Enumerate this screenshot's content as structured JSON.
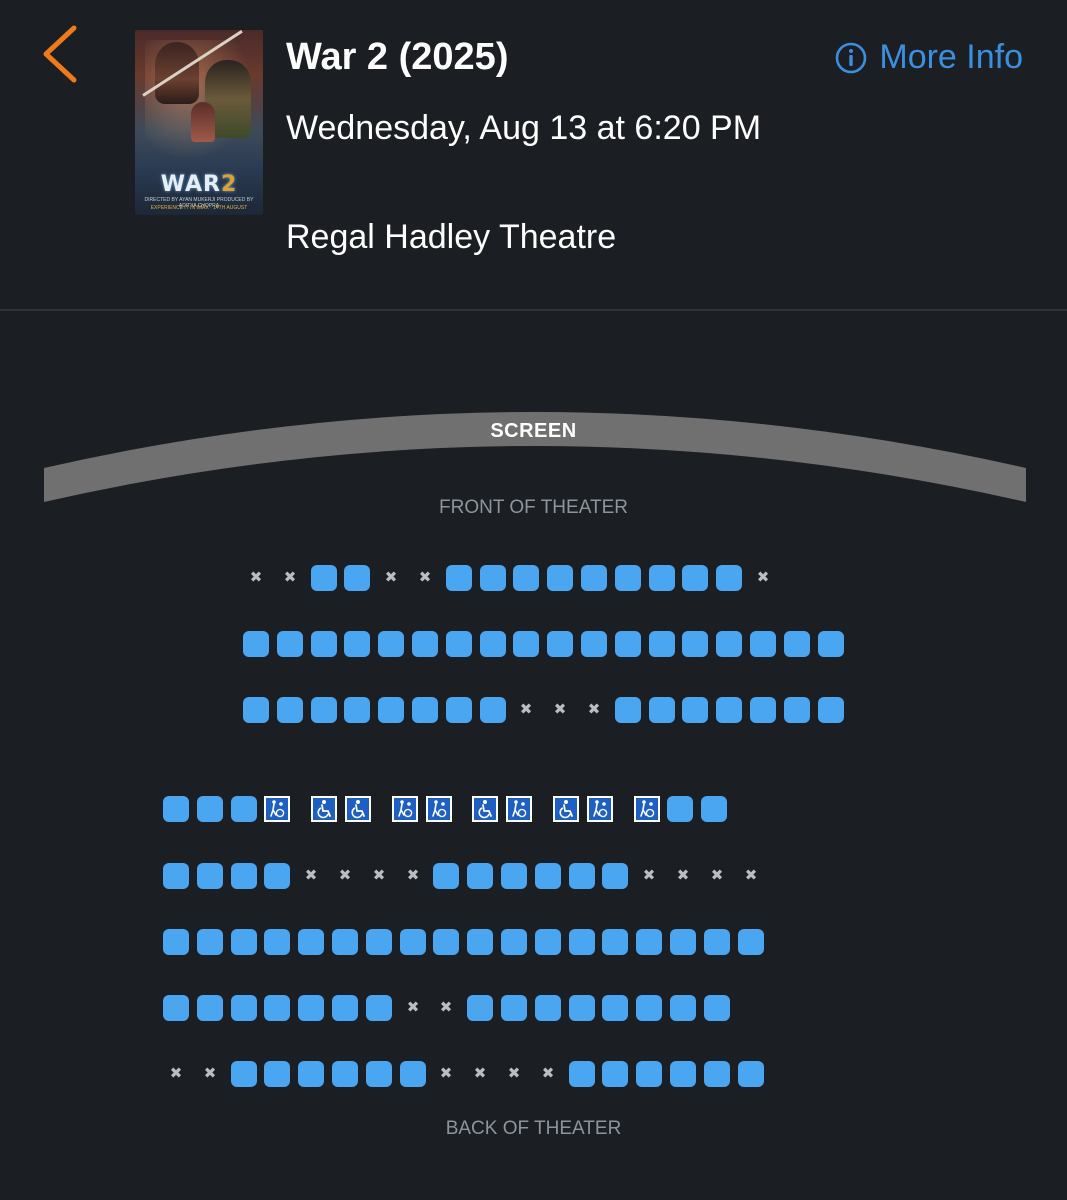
{
  "header": {
    "back_icon": "chevron-left-icon",
    "poster": {
      "title_part1": "WAR",
      "title_part2": "2",
      "credits": "DIRECTED BY AYAN MUKERJI   PRODUCED BY ADITYA CHOPRA",
      "imax": "EXPERIENCE IT IN IMAX · 14TH AUGUST"
    },
    "movie_title": "War 2 (2025)",
    "showtime": "Wednesday, Aug 13 at 6:20 PM",
    "theatre": "Regal Hadley Theatre",
    "more_info_label": "More Info",
    "more_info_icon": "info-circle-icon"
  },
  "seatmap": {
    "screen_label": "SCREEN",
    "front_label": "FRONT OF THEATER",
    "back_label": "BACK OF THEATER",
    "legend_codes": {
      "A": "available",
      "X": "unavailable",
      "W": "wheelchair-space",
      "C": "companion-seat",
      "_": "gap"
    },
    "colors": {
      "available": "#4aa6f0",
      "unavailable": "#b9bec4",
      "accessible_bg": "#1e5fc4",
      "accent_back": "#f07a1a",
      "link": "#3a8fde"
    },
    "front_section": [
      "XXAAXXAAAAAAAAAX",
      "AAAAAAAAAAAAAAAAAA",
      "AAAAAAAAXXXAAAAAAA"
    ],
    "rear_section": [
      "AAAC_WW_CC_WC_WC_CAA",
      "AAAAXXXXAAAAAAXXXX",
      "AAAAAAAAAAAAAAAAAA",
      "AAAAAAAXXAAAAAAAA",
      "XXAAAAAAXXXXAAAAAA"
    ]
  }
}
